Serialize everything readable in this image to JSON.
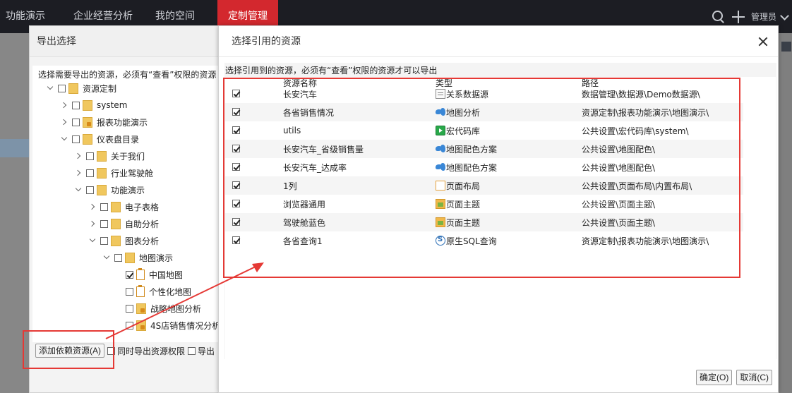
{
  "topnav": {
    "items": [
      "功能演示",
      "企业经营分析",
      "我的空间",
      "定制管理"
    ],
    "active_index": 3,
    "user": "管理员",
    "accent_color": "#d3282e",
    "bg_color": "#1c1d23"
  },
  "export_dialog": {
    "title": "导出选择",
    "tip": "选择需要导出的资源，必须有“查看”权限的资源",
    "tree": [
      {
        "label": "资源定制",
        "level": 0,
        "expand": "down",
        "icon": "folder-icon",
        "checked": false
      },
      {
        "label": "system",
        "level": 1,
        "expand": "right",
        "icon": "folder-icon",
        "checked": false
      },
      {
        "label": "报表功能演示",
        "level": 1,
        "expand": "right",
        "icon": "locked-folder-icon",
        "checked": false
      },
      {
        "label": "仪表盘目录",
        "level": 1,
        "expand": "down",
        "icon": "folder-icon",
        "checked": false
      },
      {
        "label": "关于我们",
        "level": 2,
        "expand": "right",
        "icon": "folder-icon",
        "checked": false
      },
      {
        "label": "行业驾驶舱",
        "level": 2,
        "expand": "right",
        "icon": "folder-icon",
        "checked": false
      },
      {
        "label": "功能演示",
        "level": 2,
        "expand": "down",
        "icon": "folder-icon",
        "checked": false
      },
      {
        "label": "电子表格",
        "level": 3,
        "expand": "right",
        "icon": "folder-icon",
        "checked": false
      },
      {
        "label": "自助分析",
        "level": 3,
        "expand": "right",
        "icon": "folder-icon",
        "checked": false
      },
      {
        "label": "图表分析",
        "level": 3,
        "expand": "down",
        "icon": "folder-icon",
        "checked": false
      },
      {
        "label": "地图演示",
        "level": 4,
        "expand": "down",
        "icon": "folder-icon",
        "checked": false
      },
      {
        "label": "中国地图",
        "level": 5,
        "expand": "none",
        "icon": "clipboard-icon",
        "checked": true
      },
      {
        "label": "个性化地图",
        "level": 5,
        "expand": "none",
        "icon": "clipboard-icon",
        "checked": false
      },
      {
        "label": "战略地图分析",
        "level": 5,
        "expand": "none",
        "icon": "locked-folder-icon",
        "checked": false
      },
      {
        "label": "4S店销售情况分析",
        "level": 5,
        "expand": "none",
        "icon": "locked-folder-icon",
        "checked": false
      }
    ],
    "add_dependency_label": "添加依赖资源(A)",
    "export_permission_label": "同时导出资源权限",
    "export_more_label": "导出"
  },
  "main_dialog": {
    "title": "选择引用的资源",
    "tip": "选择引用到的资源，必须有“查看”权限的资源才可以导出",
    "columns": {
      "name": "资源名称",
      "type": "类型",
      "path": "路径"
    },
    "rows": [
      {
        "checked": true,
        "name": "长安汽车",
        "type": "关系数据源",
        "type_icon": "database-icon",
        "path": "数据管理\\数据源\\Demo数据源\\"
      },
      {
        "checked": true,
        "name": "各省销售情况",
        "type": "地图分析",
        "type_icon": "map-icon",
        "path": "资源定制\\报表功能演示\\地图演示\\"
      },
      {
        "checked": true,
        "name": "utils",
        "type": "宏代码库",
        "type_icon": "macro-icon",
        "path": "公共设置\\宏代码库\\system\\"
      },
      {
        "checked": true,
        "name": "长安汽车_省级销售量",
        "type": "地图配色方案",
        "type_icon": "map-icon",
        "path": "公共设置\\地图配色\\"
      },
      {
        "checked": true,
        "name": "长安汽车_达成率",
        "type": "地图配色方案",
        "type_icon": "map-icon",
        "path": "公共设置\\地图配色\\"
      },
      {
        "checked": true,
        "name": "1列",
        "type": "页面布局",
        "type_icon": "layout-icon",
        "path": "公共设置\\页面布局\\内置布局\\"
      },
      {
        "checked": true,
        "name": "浏览器通用",
        "type": "页面主题",
        "type_icon": "theme-icon",
        "path": "公共设置\\页面主题\\"
      },
      {
        "checked": true,
        "name": "驾驶舱蓝色",
        "type": "页面主题",
        "type_icon": "theme-icon",
        "path": "公共设置\\页面主题\\"
      },
      {
        "checked": true,
        "name": "各省查询1",
        "type": "原生SQL查询",
        "type_icon": "sql-icon",
        "path": "资源定制\\报表功能演示\\地图演示\\"
      }
    ],
    "ok_label": "确定(O)",
    "cancel_label": "取消(C)"
  },
  "annotation_color": "#e53935"
}
